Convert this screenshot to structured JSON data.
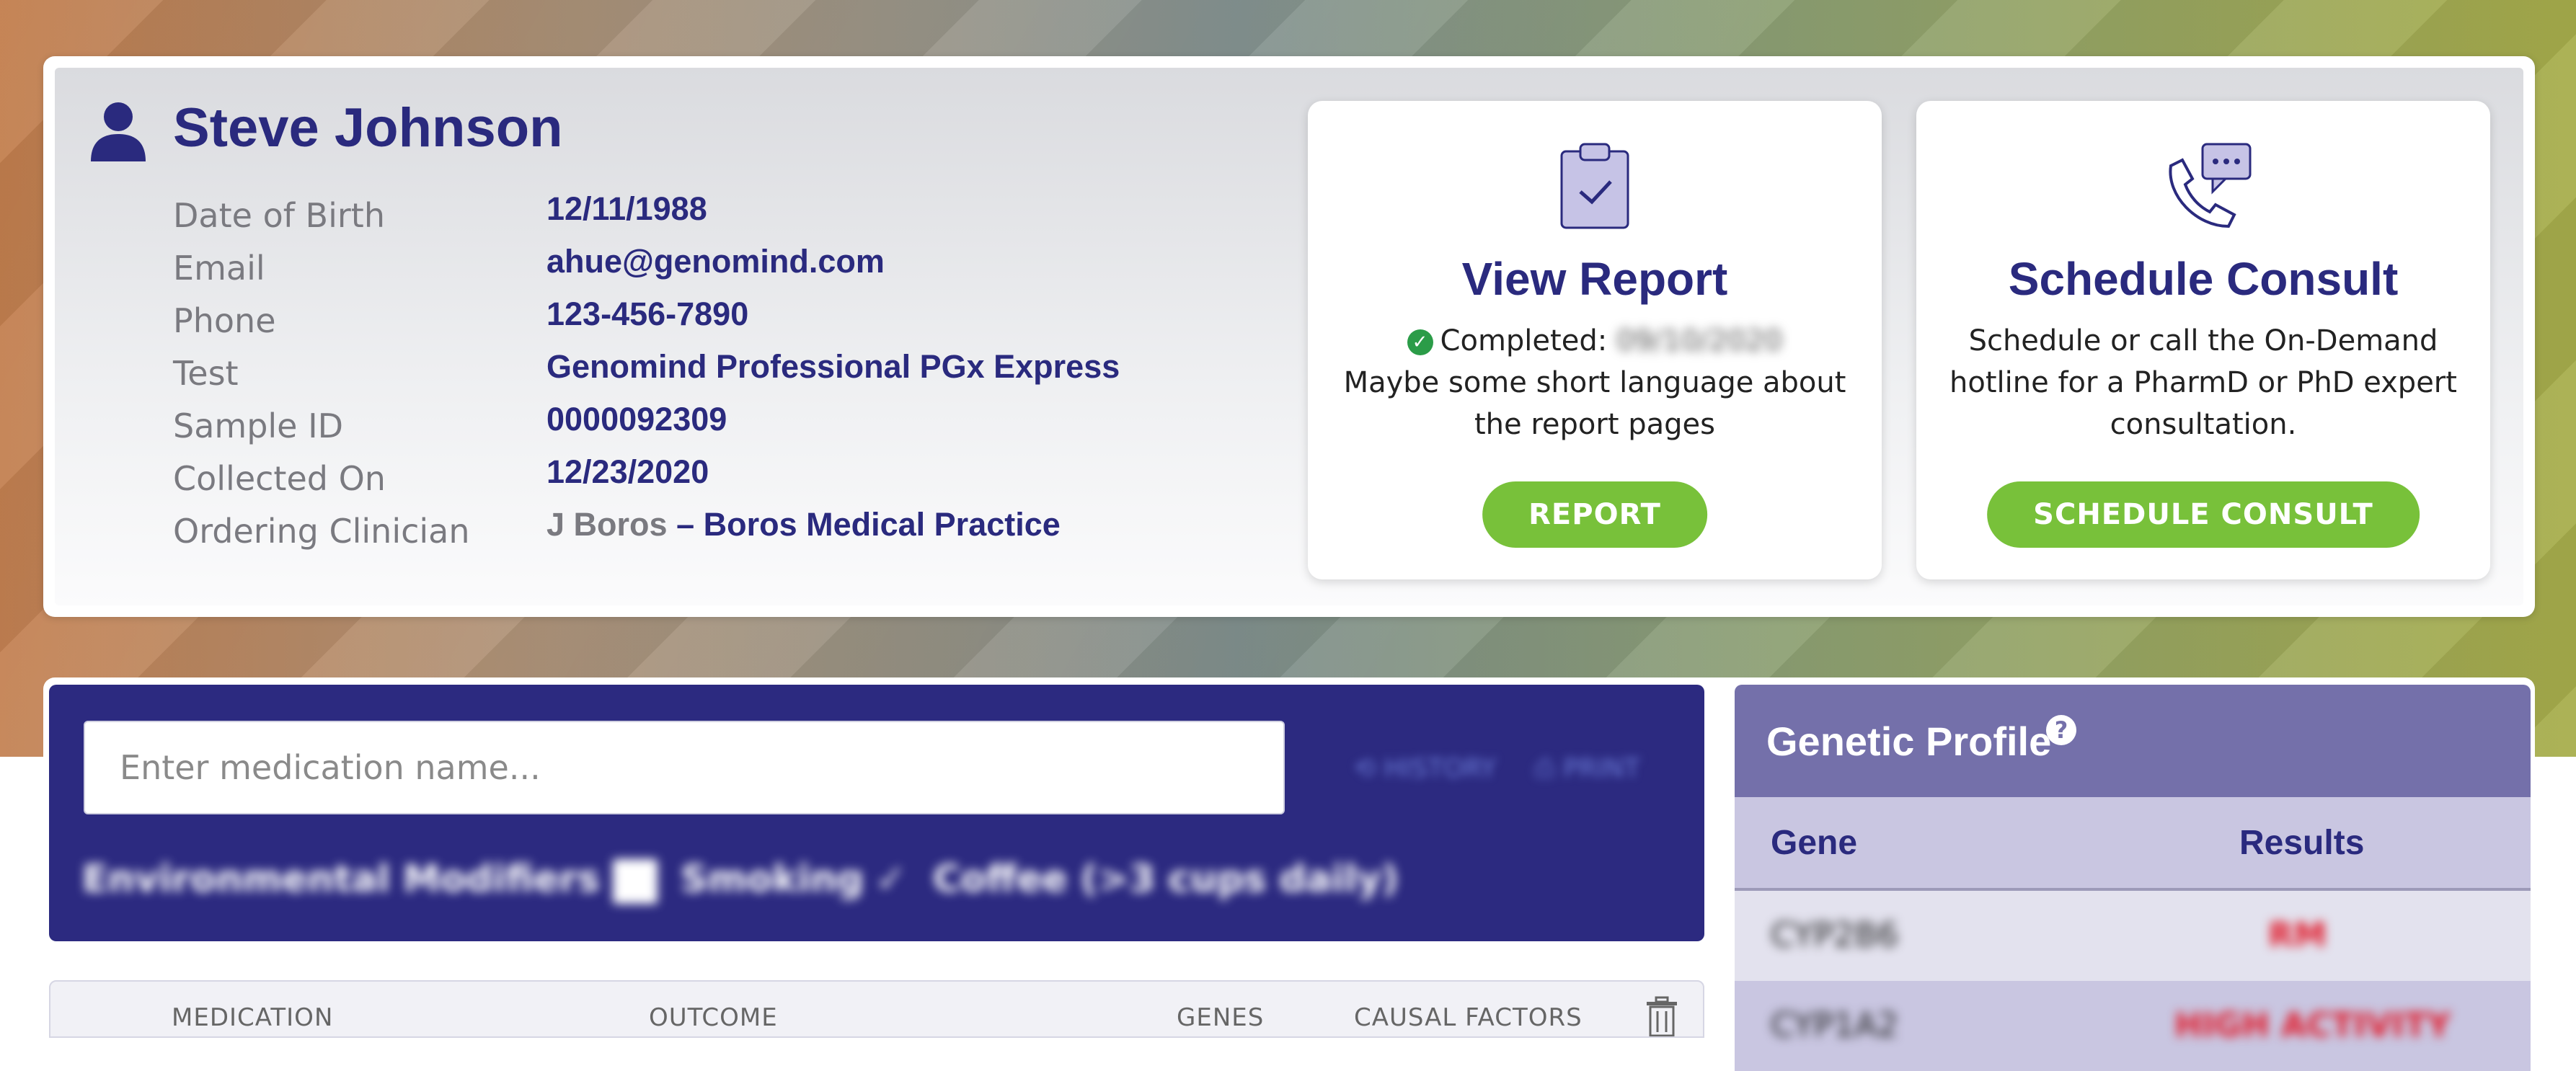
{
  "patient": {
    "name": "Steve Johnson",
    "fields": [
      {
        "label": "Date of Birth",
        "value": "12/11/1988"
      },
      {
        "label": "Email",
        "value": "ahue@genomind.com"
      },
      {
        "label": "Phone",
        "value": "123-456-7890"
      },
      {
        "label": "Test",
        "value": "Genomind Professional PGx Express"
      },
      {
        "label": "Sample ID",
        "value": "0000092309"
      },
      {
        "label": "Collected On",
        "value": "12/23/2020"
      }
    ],
    "clinician": {
      "label": "Ordering Clinician",
      "name": "J Boros",
      "practice": "– Boros Medical Practice"
    }
  },
  "report_card": {
    "title": "View Report",
    "status_label": "Completed:",
    "status_date": "09/10/2020",
    "body": "Maybe some short language about the report pages",
    "button": "REPORT"
  },
  "consult_card": {
    "title": "Schedule Consult",
    "body": "Schedule or call the On-Demand hotline for a PharmD or PhD expert consultation.",
    "button": "SCHEDULE CONSULT"
  },
  "medication": {
    "placeholder": "Enter medication name...",
    "history_label": "HISTORY",
    "print_label": "PRINT",
    "env_label": "Environmental Modifiers",
    "smoking_label": "Smoking",
    "coffee_label": "Coffee (>3 cups daily)"
  },
  "med_table": {
    "columns": [
      "MEDICATION",
      "OUTCOME",
      "GENES",
      "CAUSAL FACTORS"
    ]
  },
  "genetic_profile": {
    "title": "Genetic Profile",
    "col_gene": "Gene",
    "col_results": "Results",
    "rows": [
      {
        "gene": "CYP2B6",
        "result": "RM"
      },
      {
        "gene": "CYP1A2",
        "result": "HIGH ACTIVITY"
      }
    ]
  },
  "colors": {
    "navy": "#2a2a7e",
    "green_button": "#78c13a",
    "purple_header": "#7470aa",
    "medication_panel": "#2c2a80"
  }
}
